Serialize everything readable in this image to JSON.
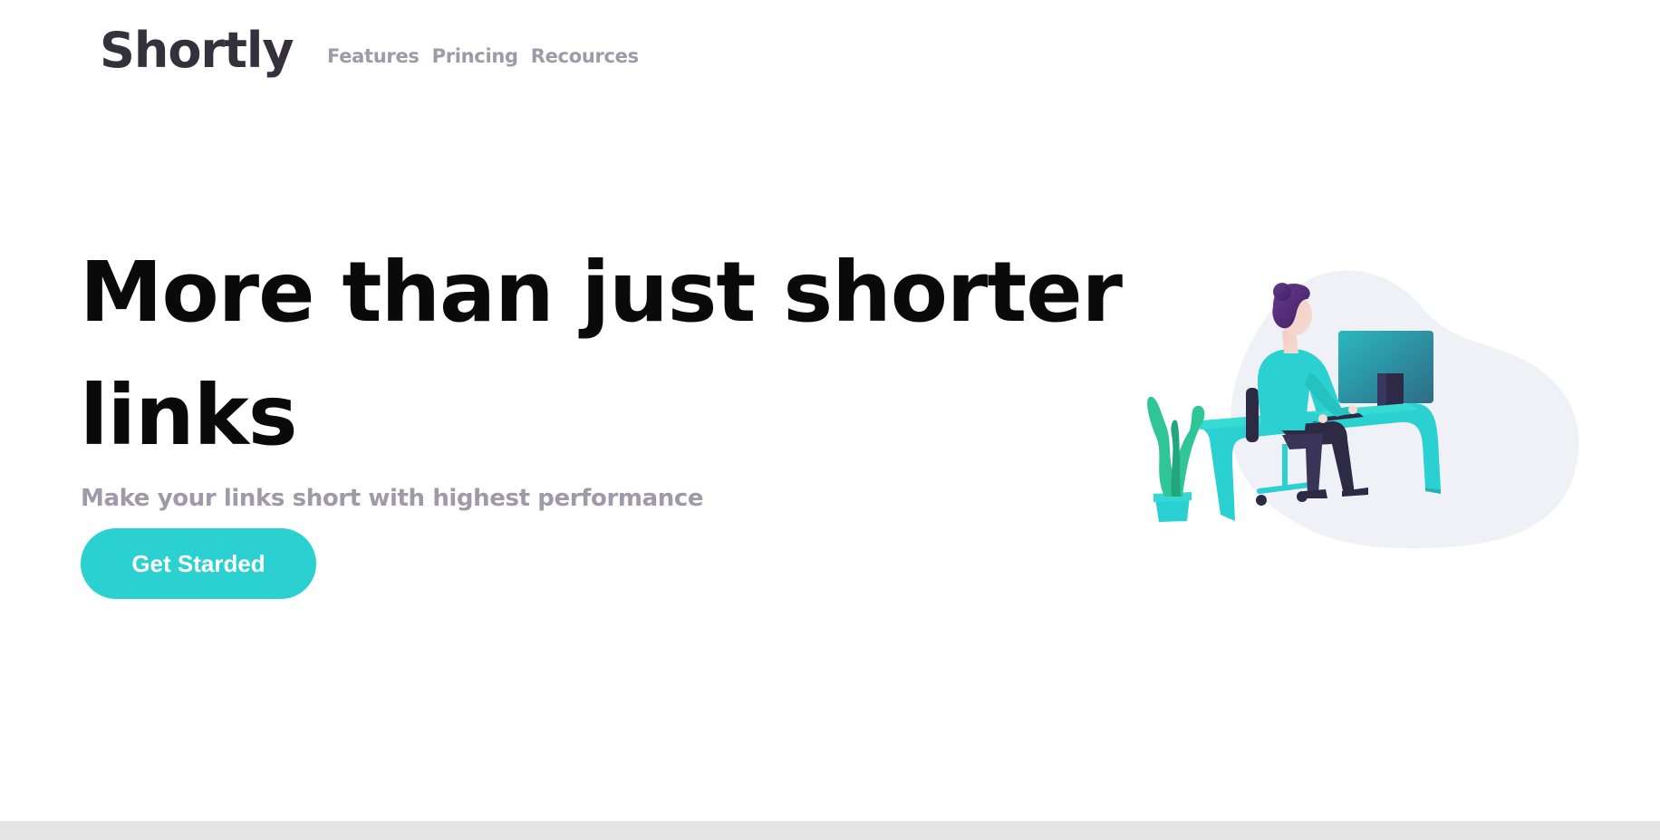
{
  "brand": {
    "name": "Shortly"
  },
  "nav": {
    "items": [
      {
        "label": "Features"
      },
      {
        "label": "Princing"
      },
      {
        "label": "Recources"
      }
    ]
  },
  "hero": {
    "title": "More than just shorter links",
    "subtitle": "Make your links short with highest performance",
    "cta_label": "Get Starded"
  },
  "colors": {
    "accent": "#2bd0d0",
    "text_dark": "#34313d",
    "text_muted": "#9e9aa7",
    "blob": "#f0f1f6"
  },
  "illustration": {
    "icon": "person-working-at-desk-illustration"
  }
}
